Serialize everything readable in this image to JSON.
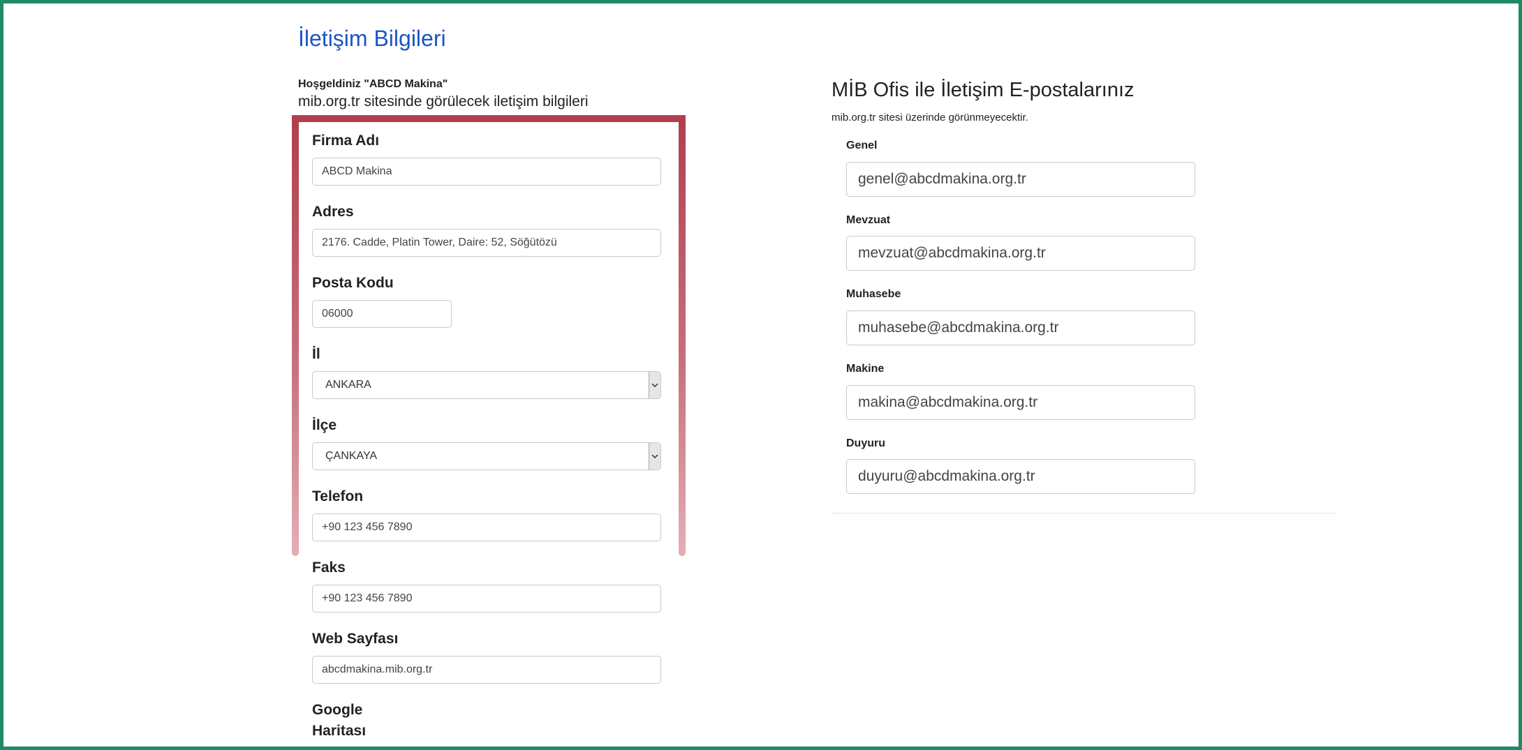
{
  "page": {
    "title": "İletişim Bilgileri",
    "welcome": "Hoşgeldiniz \"ABCD Makina\"",
    "subtitle": "mib.org.tr sitesinde görülecek iletişim bilgileri"
  },
  "contact_form": {
    "firm_name": {
      "label": "Firma Adı",
      "value": "ABCD Makina"
    },
    "address": {
      "label": "Adres",
      "value": "2176. Cadde, Platin Tower, Daire: 52, Söğütözü"
    },
    "postal_code": {
      "label": "Posta Kodu",
      "value": "06000"
    },
    "province": {
      "label": "İl",
      "value": "ANKARA"
    },
    "district": {
      "label": "İlçe",
      "value": "ÇANKAYA"
    },
    "phone": {
      "label": "Telefon",
      "value": "+90 123 456 7890"
    },
    "fax": {
      "label": "Faks",
      "value": "+90 123 456 7890"
    },
    "website": {
      "label": "Web Sayfası",
      "value": "abcdmakina.mib.org.tr"
    },
    "google_maps": {
      "label_line1": "Google",
      "label_line2": "Haritası"
    }
  },
  "emails": {
    "title": "MİB Ofis ile İletişim E-postalarınız",
    "note": "mib.org.tr sitesi üzerinde görünmeyecektir.",
    "general": {
      "label": "Genel",
      "value": "genel@abcdmakina.org.tr"
    },
    "legislation": {
      "label": "Mevzuat",
      "value": "mevzuat@abcdmakina.org.tr"
    },
    "accounting": {
      "label": "Muhasebe",
      "value": "muhasebe@abcdmakina.org.tr"
    },
    "machine": {
      "label": "Makine",
      "value": "makina@abcdmakina.org.tr"
    },
    "announcement": {
      "label": "Duyuru",
      "value": "duyuru@abcdmakina.org.tr"
    }
  },
  "colors": {
    "frame_border": "#1f8a68",
    "title_blue": "#1a56c4",
    "highlight": "#b13e4e"
  },
  "icons": {
    "select_arrow": "chevron-down-icon"
  }
}
